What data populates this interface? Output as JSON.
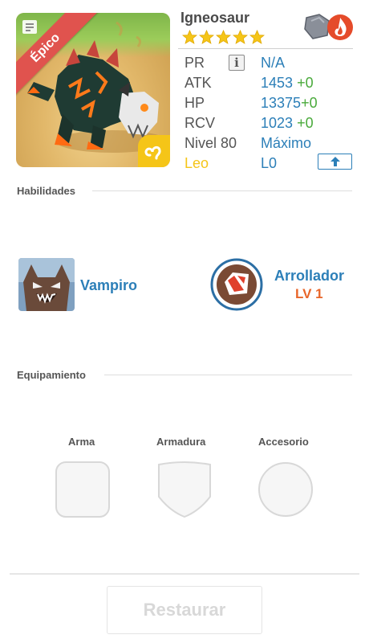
{
  "monster": {
    "name": "Igneosaur",
    "rarity": "Épico",
    "star_count": 5,
    "rarity_color": "#e0534e",
    "zodiac_color": "#f5c518",
    "elements": [
      "stone-element-icon",
      "fire-element-icon"
    ]
  },
  "stats": {
    "pr": {
      "label": "PR",
      "value": "N/A"
    },
    "atk": {
      "label": "ATK",
      "value": "1453",
      "bonus": "+0"
    },
    "hp": {
      "label": "HP",
      "value": "13375",
      "bonus": "+0"
    },
    "rcv": {
      "label": "RCV",
      "value": "1023",
      "bonus": "+0"
    },
    "level": {
      "label": "Nivel 80",
      "value": "Máximo"
    },
    "zodiac": {
      "label": "Leo",
      "value": "L0"
    }
  },
  "abilities": {
    "title": "Habilidades",
    "items": [
      {
        "name": "Vampiro"
      },
      {
        "name": "Arrollador",
        "level": "LV 1"
      }
    ]
  },
  "equipment": {
    "title": "Equipamiento",
    "slots": [
      {
        "label": "Arma"
      },
      {
        "label": "Armadura"
      },
      {
        "label": "Accesorio"
      }
    ]
  },
  "footer": {
    "restore_label": "Restaurar"
  },
  "colors": {
    "value_blue": "#2c7fb8",
    "bonus_green": "#4aaa3c",
    "level_orange": "#e8662a"
  }
}
